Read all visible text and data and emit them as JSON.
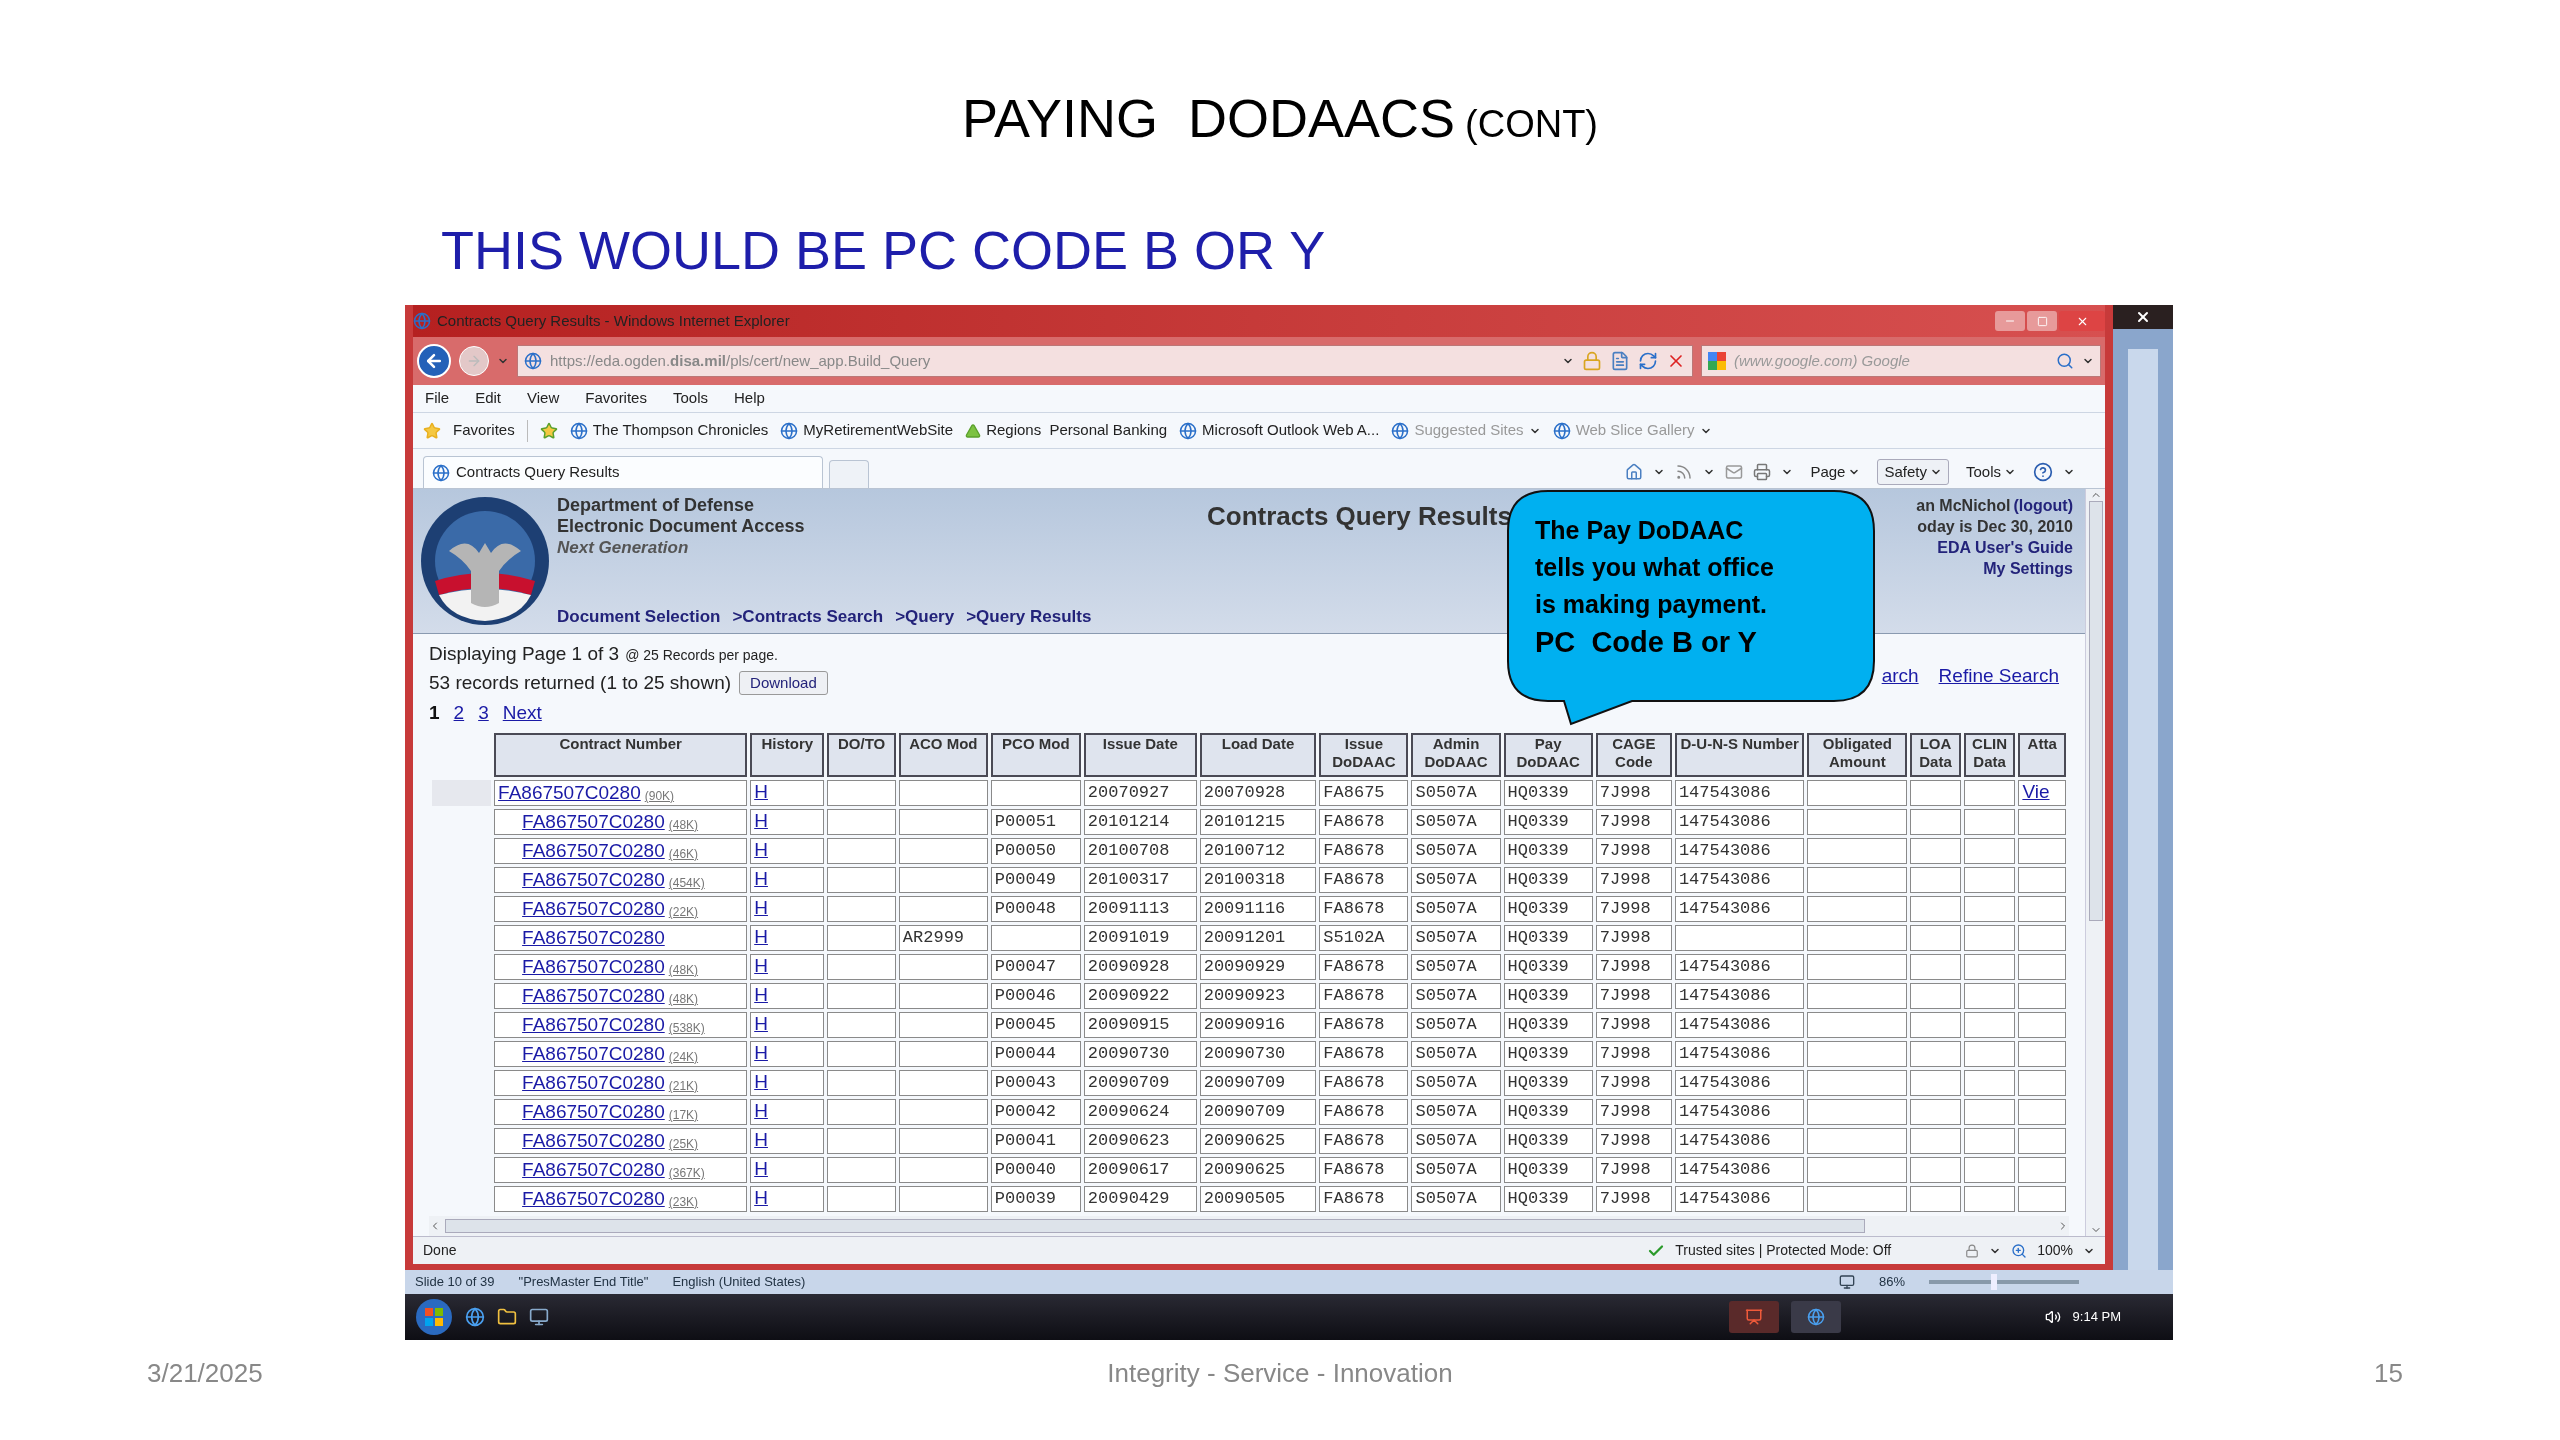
{
  "slide": {
    "title": "PAYING  DODAACS",
    "title_suffix": "(CONT)",
    "subtitle": "THIS WOULD BE PC CODE B OR Y",
    "footer_date": "3/21/2025",
    "footer_center": "Integrity - Service - Innovation",
    "page_number": "15"
  },
  "window": {
    "title": "Contracts Query Results - Windows Internet Explorer"
  },
  "address_bar": {
    "url": "https://eda.ogden.**disa.mil**/pls/cert/new_app.Build_Query"
  },
  "search_field": {
    "placeholder": "(www.google.com) Google"
  },
  "menu": [
    "File",
    "Edit",
    "View",
    "Favorites",
    "Tools",
    "Help"
  ],
  "favorites_bar": {
    "label": "Favorites",
    "items": [
      {
        "label": "The Thompson Chronicles",
        "kind": "page"
      },
      {
        "label": "MyRetirementWebSite",
        "kind": "page"
      },
      {
        "label": "Regions  Personal Banking",
        "kind": "bank"
      },
      {
        "label": "Microsoft Outlook Web A...",
        "kind": "page"
      },
      {
        "label": "Suggested Sites",
        "kind": "menu"
      },
      {
        "label": "Web Slice Gallery",
        "kind": "menu"
      }
    ]
  },
  "tabs": [
    {
      "label": "Contracts Query Results",
      "selected": true
    }
  ],
  "command_bar": [
    {
      "label": "Page",
      "selected": false
    },
    {
      "label": "Safety",
      "selected": true
    },
    {
      "label": "Tools",
      "selected": false
    }
  ],
  "page": {
    "org_lines": [
      "Department of Defense",
      "Electronic Document Access"
    ],
    "tagline": "Next Generation",
    "heading": "Contracts Query Results",
    "breadcrumbs": [
      "Document Selection",
      ">Contracts Search",
      ">Query",
      ">Query Results"
    ],
    "user": "an McNichol",
    "logout": "(logout)",
    "date": "oday is Dec 30, 2010",
    "links": [
      "EDA User's Guide",
      "My Settings"
    ],
    "summary": "Displaying Page 1 of 3",
    "per_page": "@ 25 Records per page.",
    "returned": "53 records returned (1 to 25 shown)",
    "download": "Download",
    "pages": [
      {
        "label": "1",
        "selected": true
      },
      {
        "label": "2",
        "selected": false
      },
      {
        "label": "3",
        "selected": false
      },
      {
        "label": "Next",
        "selected": false
      }
    ],
    "search_links": [
      "arch",
      "Refine Search"
    ]
  },
  "table": {
    "columns": [
      "Contract Number",
      "History",
      "DO/TO",
      "ACO Mod",
      "PCO Mod",
      "Issue Date",
      "Load Date",
      "Issue DoDAAC",
      "Admin DoDAAC",
      "Pay DoDAAC",
      "CAGE Code",
      "D-U-N-S Number",
      "Obligated Amount",
      "LOA Data",
      "CLIN Data",
      "Atta"
    ],
    "rows": [
      {
        "contract": "FA867507C0280",
        "size": "(90K)",
        "history": "H",
        "issue_date": "20070927",
        "load_date": "20070928",
        "issue_dodaac": "FA8675",
        "admin_dodaac": "S0507A",
        "pay_dodaac": "HQ0339",
        "cage_code": "7J998",
        "duns": "147543086",
        "attachment": "Vie",
        "children": [
          {
            "contract": "FA867507C0280",
            "size": "(48K)",
            "history": "H",
            "pco_mod": "P00051",
            "issue_date": "20101214",
            "load_date": "20101215",
            "issue_dodaac": "FA8678",
            "admin_dodaac": "S0507A",
            "pay_dodaac": "HQ0339",
            "cage_code": "7J998",
            "duns": "147543086"
          },
          {
            "contract": "FA867507C0280",
            "size": "(46K)",
            "history": "H",
            "pco_mod": "P00050",
            "issue_date": "20100708",
            "load_date": "20100712",
            "issue_dodaac": "FA8678",
            "admin_dodaac": "S0507A",
            "pay_dodaac": "HQ0339",
            "cage_code": "7J998",
            "duns": "147543086"
          },
          {
            "contract": "FA867507C0280",
            "size": "(454K)",
            "history": "H",
            "pco_mod": "P00049",
            "issue_date": "20100317",
            "load_date": "20100318",
            "issue_dodaac": "FA8678",
            "admin_dodaac": "S0507A",
            "pay_dodaac": "HQ0339",
            "cage_code": "7J998",
            "duns": "147543086"
          },
          {
            "contract": "FA867507C0280",
            "size": "(22K)",
            "history": "H",
            "pco_mod": "P00048",
            "issue_date": "20091113",
            "load_date": "20091116",
            "issue_dodaac": "FA8678",
            "admin_dodaac": "S0507A",
            "pay_dodaac": "HQ0339",
            "cage_code": "7J998",
            "duns": "147543086"
          },
          {
            "contract": "FA867507C0280",
            "history": "H",
            "aco_mod": "AR2999",
            "issue_date": "20091019",
            "load_date": "20091201",
            "issue_dodaac": "S5102A",
            "admin_dodaac": "S0507A",
            "pay_dodaac": "HQ0339",
            "cage_code": "7J998"
          },
          {
            "contract": "FA867507C0280",
            "size": "(48K)",
            "history": "H",
            "pco_mod": "P00047",
            "issue_date": "20090928",
            "load_date": "20090929",
            "issue_dodaac": "FA8678",
            "admin_dodaac": "S0507A",
            "pay_dodaac": "HQ0339",
            "cage_code": "7J998",
            "duns": "147543086"
          },
          {
            "contract": "FA867507C0280",
            "size": "(48K)",
            "history": "H",
            "pco_mod": "P00046",
            "issue_date": "20090922",
            "load_date": "20090923",
            "issue_dodaac": "FA8678",
            "admin_dodaac": "S0507A",
            "pay_dodaac": "HQ0339",
            "cage_code": "7J998",
            "duns": "147543086"
          },
          {
            "contract": "FA867507C0280",
            "size": "(538K)",
            "history": "H",
            "pco_mod": "P00045",
            "issue_date": "20090915",
            "load_date": "20090916",
            "issue_dodaac": "FA8678",
            "admin_dodaac": "S0507A",
            "pay_dodaac": "HQ0339",
            "cage_code": "7J998",
            "duns": "147543086"
          },
          {
            "contract": "FA867507C0280",
            "size": "(24K)",
            "history": "H",
            "pco_mod": "P00044",
            "issue_date": "20090730",
            "load_date": "20090730",
            "issue_dodaac": "FA8678",
            "admin_dodaac": "S0507A",
            "pay_dodaac": "HQ0339",
            "cage_code": "7J998",
            "duns": "147543086"
          },
          {
            "contract": "FA867507C0280",
            "size": "(21K)",
            "history": "H",
            "pco_mod": "P00043",
            "issue_date": "20090709",
            "load_date": "20090709",
            "issue_dodaac": "FA8678",
            "admin_dodaac": "S0507A",
            "pay_dodaac": "HQ0339",
            "cage_code": "7J998",
            "duns": "147543086"
          },
          {
            "contract": "FA867507C0280",
            "size": "(17K)",
            "history": "H",
            "pco_mod": "P00042",
            "issue_date": "20090624",
            "load_date": "20090709",
            "issue_dodaac": "FA8678",
            "admin_dodaac": "S0507A",
            "pay_dodaac": "HQ0339",
            "cage_code": "7J998",
            "duns": "147543086"
          },
          {
            "contract": "FA867507C0280",
            "size": "(25K)",
            "history": "H",
            "pco_mod": "P00041",
            "issue_date": "20090623",
            "load_date": "20090625",
            "issue_dodaac": "FA8678",
            "admin_dodaac": "S0507A",
            "pay_dodaac": "HQ0339",
            "cage_code": "7J998",
            "duns": "147543086"
          },
          {
            "contract": "FA867507C0280",
            "size": "(367K)",
            "history": "H",
            "pco_mod": "P00040",
            "issue_date": "20090617",
            "load_date": "20090625",
            "issue_dodaac": "FA8678",
            "admin_dodaac": "S0507A",
            "pay_dodaac": "HQ0339",
            "cage_code": "7J998",
            "duns": "147543086"
          },
          {
            "contract": "FA867507C0280",
            "size": "(23K)",
            "history": "H",
            "pco_mod": "P00039",
            "issue_date": "20090429",
            "load_date": "20090505",
            "issue_dodaac": "FA8678",
            "admin_dodaac": "S0507A",
            "pay_dodaac": "HQ0339",
            "cage_code": "7J998",
            "duns": "147543086"
          }
        ]
      }
    ]
  },
  "callout": {
    "text": "The Pay DoDAAC tells you what office is making payment.",
    "emphasis": "PC  Code B or Y"
  },
  "status_bar": {
    "status": "Done",
    "zone": "Trusted sites | Protected Mode: Off",
    "zoom": "100%"
  },
  "app_status_bar": {
    "slide": "Slide 10 of 39",
    "theme": "\"PresMaster End Title\"",
    "language": "English (United States)",
    "zoom": "86%",
    "zoom_slider": {
      "level": 0.43
    }
  },
  "taskbar": {
    "clock": "9:14 PM"
  }
}
